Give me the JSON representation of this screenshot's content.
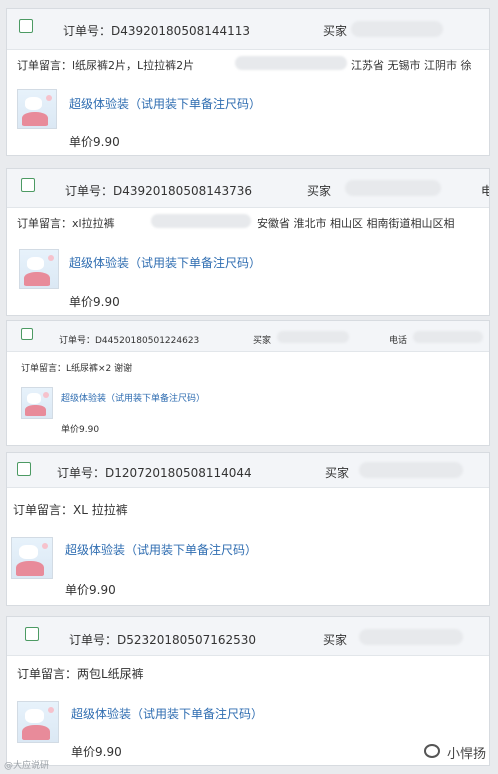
{
  "orders": [
    {
      "order_label": "订单号：D43920180508144113",
      "buyer_label": "买家",
      "memo": "订单留言：l纸尿裤2片，L拉拉裤2片",
      "address": "江苏省 无锡市 江阴市 徐",
      "product": "超级体验装（试用装下单备注尺码）",
      "price": "单价9.90",
      "corner": ""
    },
    {
      "order_label": "订单号：D43920180508143736",
      "buyer_label": "买家",
      "memo": "订单留言：xl拉拉裤",
      "address": "安徽省 淮北市 相山区 相南街道相山区相",
      "product": "超级体验装（试用装下单备注尺码）",
      "price": "单价9.90",
      "corner": "电"
    },
    {
      "order_label": "订单号：D44520180501224623",
      "buyer_label": "买家",
      "phone_label": "电话",
      "memo": "订单留言：L纸尿裤×2 谢谢",
      "product": "超级体验装（试用装下单备注尺码）",
      "price": "单价9.90"
    },
    {
      "order_label": "订单号：D120720180508114044",
      "buyer_label": "买家",
      "memo": "订单留言：XL 拉拉裤",
      "product": "超级体验装（试用装下单备注尺码）",
      "price": "单价9.90"
    },
    {
      "order_label": "订单号：D52320180507162530",
      "buyer_label": "买家",
      "memo": "订单留言：两包L纸尿裤",
      "product": "超级体验装（试用装下单备注尺码）",
      "price": "单价9.90"
    }
  ],
  "watermark_left": "@大应说研",
  "watermark_right": "小悍扬",
  "icons": {
    "checkbox": "checkbox-icon",
    "product": "product-thumbnail-icon",
    "wechat": "wechat-logo-icon"
  }
}
